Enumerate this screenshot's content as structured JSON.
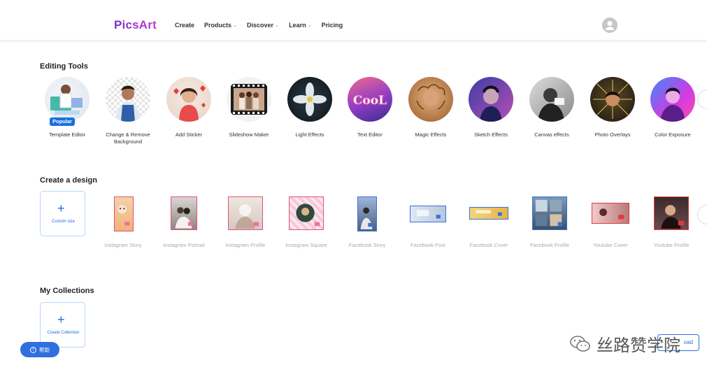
{
  "header": {
    "logo": "PicsArt",
    "nav": [
      {
        "label": "Create",
        "has_chevron": false
      },
      {
        "label": "Products",
        "has_chevron": true
      },
      {
        "label": "Discover",
        "has_chevron": true
      },
      {
        "label": "Learn",
        "has_chevron": true
      },
      {
        "label": "Pricing",
        "has_chevron": false
      }
    ],
    "chevron_glyph": "⌄"
  },
  "editing_tools": {
    "title": "Editing Tools",
    "badge": "Popular",
    "items": [
      {
        "label": "Template Editor"
      },
      {
        "label": "Change & Remove Background"
      },
      {
        "label": "Add Sticker"
      },
      {
        "label": "Slideshow Maker"
      },
      {
        "label": "Light Effects"
      },
      {
        "label": "Text Editor",
        "art_text": "CooL"
      },
      {
        "label": "Magic Effects"
      },
      {
        "label": "Sketch Effects"
      },
      {
        "label": "Canvas effects"
      },
      {
        "label": "Photo Overlays"
      },
      {
        "label": "Color Exposure"
      }
    ]
  },
  "create_design": {
    "title": "Create a design",
    "custom_size": {
      "plus": "+",
      "label": "Custom size"
    },
    "items": [
      {
        "label": "Instagram Story"
      },
      {
        "label": "Instagram Portrait"
      },
      {
        "label": "Instagram Profile"
      },
      {
        "label": "Instagram Square"
      },
      {
        "label": "Facebook Story"
      },
      {
        "label": "Facebook Post"
      },
      {
        "label": "Facebook Cover"
      },
      {
        "label": "Facebook Profile"
      },
      {
        "label": "Youtube Cover"
      },
      {
        "label": "Youtube Profile"
      }
    ]
  },
  "collections": {
    "title": "My Collections",
    "create": {
      "plus": "+",
      "label": "Create Collection"
    }
  },
  "help": {
    "icon": "?",
    "label": "帮助"
  },
  "upload": {
    "label": "oad"
  },
  "watermark": {
    "text": "丝路赞学院"
  },
  "colors": {
    "accent": "#1a6fe0",
    "instagram": "#e0507a",
    "facebook": "#3b6fd8",
    "youtube": "#e03a3a"
  }
}
